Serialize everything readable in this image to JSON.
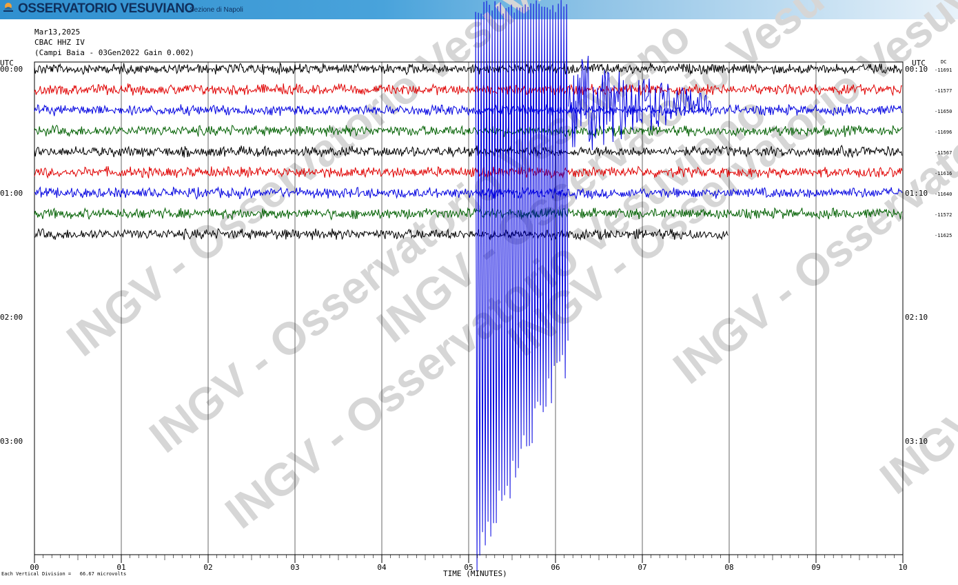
{
  "header": {
    "title": "OSSERVATORIO VESUVIANO",
    "subtitle": "Sezione di Napoli",
    "logo_text": "INGV"
  },
  "info": {
    "date": "Mar13,2025",
    "station": "CBAC HHZ IV",
    "description": "(Campi Baia - 03Gen2022 Gain 0.002)"
  },
  "axes": {
    "left_title": "UTC",
    "right_title": "UTC",
    "dc_title": "DC",
    "x_title": "TIME (MINUTES)",
    "footnote": "Each Vertical Division =   66.67 microvolts"
  },
  "watermark": "INGV - Osservatorio Vesuviano",
  "chart_data": {
    "type": "line",
    "title": "",
    "xlabel": "TIME (MINUTES)",
    "xlim": [
      0,
      10
    ],
    "x_ticks": [
      "00",
      "01",
      "02",
      "03",
      "04",
      "05",
      "06",
      "07",
      "08",
      "09",
      "10"
    ],
    "row_interval_minutes": 10,
    "left_time_labels": [
      {
        "row": 0,
        "label": "00:00"
      },
      {
        "row": 6,
        "label": "01:00"
      },
      {
        "row": 12,
        "label": "02:00"
      },
      {
        "row": 18,
        "label": "03:00"
      }
    ],
    "right_time_labels": [
      {
        "row": 0,
        "label": "00:10"
      },
      {
        "row": 6,
        "label": "01:10"
      },
      {
        "row": 12,
        "label": "02:10"
      },
      {
        "row": 18,
        "label": "03:10"
      }
    ],
    "color_cycle": [
      "#000000",
      "#e00000",
      "#0000e0",
      "#006000"
    ],
    "traces": [
      {
        "row": 0,
        "color": "#000000",
        "dc": "-11691",
        "end_minute": 10
      },
      {
        "row": 1,
        "color": "#e00000",
        "dc": "-11577",
        "end_minute": 10
      },
      {
        "row": 2,
        "color": "#0000e0",
        "dc": "-11650",
        "end_minute": 10,
        "event_start_minute": 5.08,
        "event_end_minute": 6.15
      },
      {
        "row": 3,
        "color": "#006000",
        "dc": "-11696",
        "end_minute": 10
      },
      {
        "row": 4,
        "color": "#000000",
        "dc": "-11567",
        "end_minute": 10
      },
      {
        "row": 5,
        "color": "#e00000",
        "dc": "-11616",
        "end_minute": 10
      },
      {
        "row": 6,
        "color": "#0000e0",
        "dc": "-11640",
        "end_minute": 10
      },
      {
        "row": 7,
        "color": "#006000",
        "dc": "-11572",
        "end_minute": 10
      },
      {
        "row": 8,
        "color": "#000000",
        "dc": "-11625",
        "end_minute": 8
      }
    ],
    "units": "microvolts",
    "vertical_division_microvolts": 66.67,
    "grid": true
  }
}
